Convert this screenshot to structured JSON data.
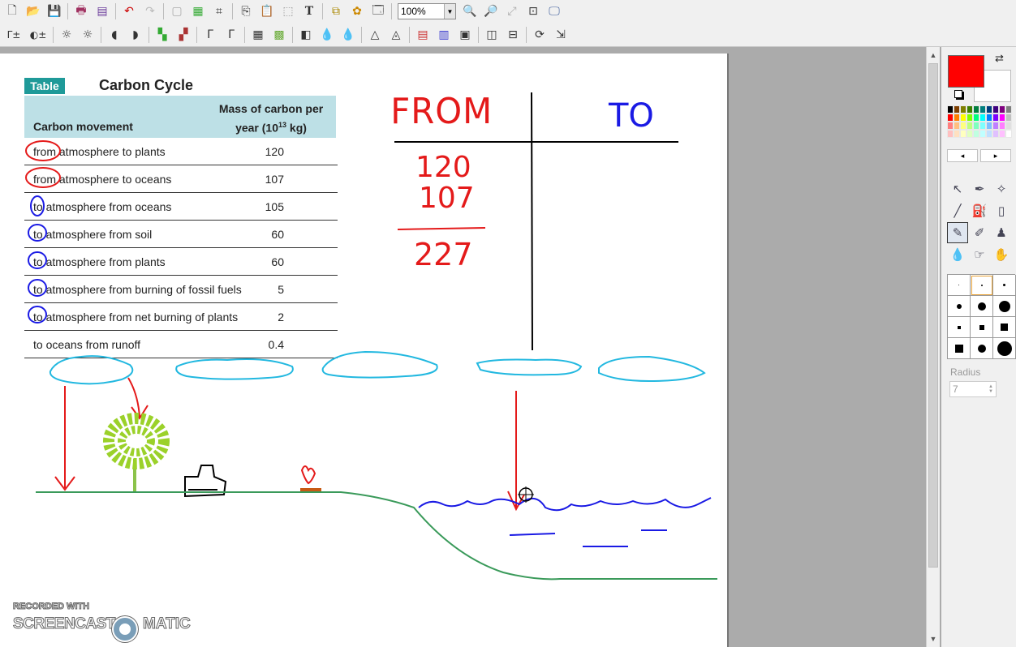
{
  "toolbar": {
    "zoom": "100%",
    "row1_icons": [
      "new-icon",
      "open-icon",
      "save-icon",
      "print-icon",
      "scan-icon",
      "undo-icon",
      "redo-icon",
      "blank-icon",
      "color-icon",
      "crop-icon",
      "copy-icon",
      "paste-icon",
      "select-icon",
      "text-icon",
      "layers-icon",
      "effects-icon",
      "window-icon",
      "zoom-in-icon",
      "zoom-out-icon",
      "fit-icon",
      "actual-size-icon",
      "fullscreen-icon"
    ],
    "row2_icons": [
      "auto-contrast-icon",
      "auto-level-icon",
      "brightness-down-icon",
      "brightness-up-icon",
      "contrast-down-icon",
      "contrast-up-icon",
      "hue-down-icon",
      "hue-up-icon",
      "gamma-down-icon",
      "gamma-up-icon",
      "grid-icon",
      "mosaic-icon",
      "invert-icon",
      "blur-icon",
      "sharpen-icon",
      "emboss-icon",
      "edge-icon",
      "gradient-icon",
      "channels-icon",
      "noise-icon",
      "flip-h-icon",
      "flip-v-icon",
      "rotate-icon",
      "resize-icon"
    ]
  },
  "table": {
    "badge": "Table",
    "title": "Carbon Cycle",
    "col_movement": "Carbon movement",
    "col_mass_line1": "Mass of carbon per",
    "col_mass_line2_pre": "year (10",
    "col_mass_sup": "13",
    "col_mass_line2_post": " kg)",
    "rows": [
      {
        "label": "from atmosphere to plants",
        "value": "120"
      },
      {
        "label": "from atmosphere to oceans",
        "value": "107"
      },
      {
        "label": "to atmosphere from oceans",
        "value": "105"
      },
      {
        "label": "to atmosphere from soil",
        "value": "60"
      },
      {
        "label": "to atmosphere from plants",
        "value": "60"
      },
      {
        "label": "to atmosphere from burning of fossil fuels",
        "value": "5"
      },
      {
        "label": "to atmosphere from net burning of plants",
        "value": "2"
      },
      {
        "label": "to oceans from runoff",
        "value": "0.4"
      }
    ]
  },
  "handwriting": {
    "from": "FROM",
    "to": "TO",
    "n1": "120",
    "n2": "107",
    "sum": "227"
  },
  "watermark": {
    "recorded_with": "RECORDED WITH",
    "screencast": "SCREENCAST",
    "matic": "MATIC"
  },
  "panel": {
    "primary_color": "#ff0000",
    "secondary_color": "#ffffff",
    "radius_label": "Radius",
    "radius_value": "7",
    "palette": [
      "#000000",
      "#7f3f00",
      "#7f7f00",
      "#3f7f00",
      "#007f3f",
      "#007f7f",
      "#003f7f",
      "#3f007f",
      "#7f007f",
      "#7f7f7f",
      "#ff0000",
      "#ff7f00",
      "#ffff00",
      "#7fff00",
      "#00ff7f",
      "#00ffff",
      "#007fff",
      "#7f00ff",
      "#ff00ff",
      "#c0c0c0",
      "#ff7f7f",
      "#ffbf7f",
      "#ffff7f",
      "#bfff7f",
      "#7fffbf",
      "#7fffff",
      "#7fbfff",
      "#bf7fff",
      "#ff7fff",
      "#e0e0e0",
      "#ffc0c0",
      "#ffe0c0",
      "#ffffc0",
      "#e0ffc0",
      "#c0ffe0",
      "#c0ffff",
      "#c0e0ff",
      "#e0c0ff",
      "#ffc0ff",
      "#ffffff"
    ],
    "tools": [
      "select-arrow-icon",
      "eyedropper-icon",
      "magic-wand-icon",
      "line-icon",
      "fill-bucket-icon",
      "spray-icon",
      "pen-icon",
      "brush-icon",
      "stamp-icon",
      "drop-icon",
      "smudge-icon",
      "hand-icon"
    ]
  }
}
